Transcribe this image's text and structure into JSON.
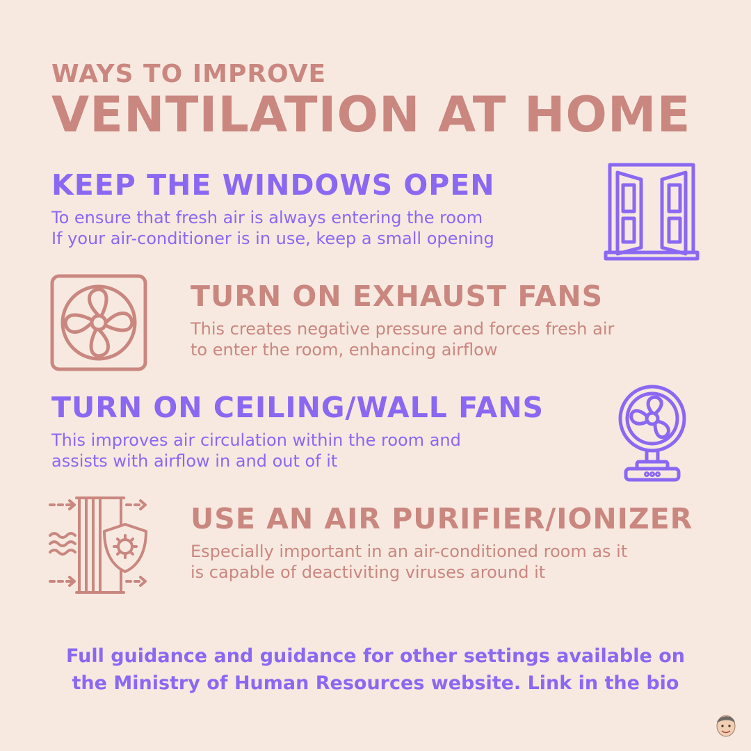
{
  "header": {
    "pretitle": "WAYS TO IMPROVE",
    "title": "VENTILATION AT HOME"
  },
  "tips": [
    {
      "heading": "KEEP THE WINDOWS OPEN",
      "line1": "To ensure that fresh air is always entering the room",
      "line2": "If your air-conditioner is in use, keep a small opening",
      "icon": "open-window-icon"
    },
    {
      "heading": "TURN ON EXHAUST FANS",
      "line1": "This creates negative pressure and forces fresh air",
      "line2": "to enter the room, enhancing airflow",
      "icon": "exhaust-fan-icon"
    },
    {
      "heading": "TURN ON CEILING/WALL FANS",
      "line1": "This improves air circulation within the room and",
      "line2": "assists with airflow in and out of it",
      "icon": "desk-fan-icon"
    },
    {
      "heading": "USE AN AIR PURIFIER/IONIZER",
      "line1": "Especially important in an air-conditioned room as it",
      "line2": "is capable of deactiviting viruses around it",
      "icon": "air-purifier-icon"
    }
  ],
  "footer": {
    "line1": "Full guidance and guidance for other settings available on",
    "line2": "the Ministry of Human Resources website. Link in the bio"
  },
  "colors": {
    "background": "#f7e9e0",
    "rose": "#c98780",
    "purple": "#8a68f2"
  }
}
